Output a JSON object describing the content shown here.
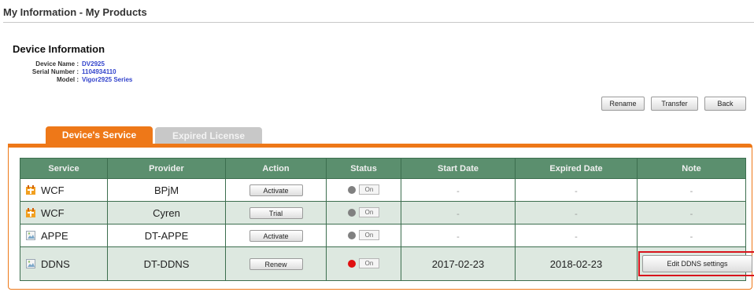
{
  "page": {
    "title": "My Information - My Products"
  },
  "device_info": {
    "heading": "Device Information",
    "fields": [
      {
        "label": "Device Name :",
        "value": "DV2925"
      },
      {
        "label": "Serial Number :",
        "value": "1104934110"
      },
      {
        "label": "Model :",
        "value": "Vigor2925 Series"
      }
    ]
  },
  "toolbar": {
    "rename": "Rename",
    "transfer": "Transfer",
    "back": "Back"
  },
  "tabs": [
    {
      "label": "Device's Service",
      "active": true
    },
    {
      "label": "Expired License",
      "active": false
    }
  ],
  "table": {
    "headers": [
      "Service",
      "Provider",
      "Action",
      "Status",
      "Start Date",
      "Expired Date",
      "Note"
    ],
    "rows": [
      {
        "service": "WCF",
        "icon": "wcf-icon",
        "provider": "BPjM",
        "action": "Activate",
        "status": "On",
        "status_active": false,
        "start": "-",
        "expired": "-",
        "note": "-"
      },
      {
        "service": "WCF",
        "icon": "wcf-icon",
        "provider": "Cyren",
        "action": "Trial",
        "status": "On",
        "status_active": false,
        "start": "-",
        "expired": "-",
        "note": "-"
      },
      {
        "service": "APPE",
        "icon": "broken-image-icon",
        "provider": "DT-APPE",
        "action": "Activate",
        "status": "On",
        "status_active": false,
        "start": "-",
        "expired": "-",
        "note": "-"
      },
      {
        "service": "DDNS",
        "icon": "broken-image-icon",
        "provider": "DT-DDNS",
        "action": "Renew",
        "status": "On",
        "status_active": true,
        "start": "2017-02-23",
        "expired": "2018-02-23",
        "note": "Edit DDNS settings"
      }
    ]
  },
  "colors": {
    "accent": "#ee7818",
    "header_bg": "#5b8f6e",
    "alt_row": "#dde8e0",
    "active_status": "#e01010",
    "highlight": "#d8141c"
  }
}
